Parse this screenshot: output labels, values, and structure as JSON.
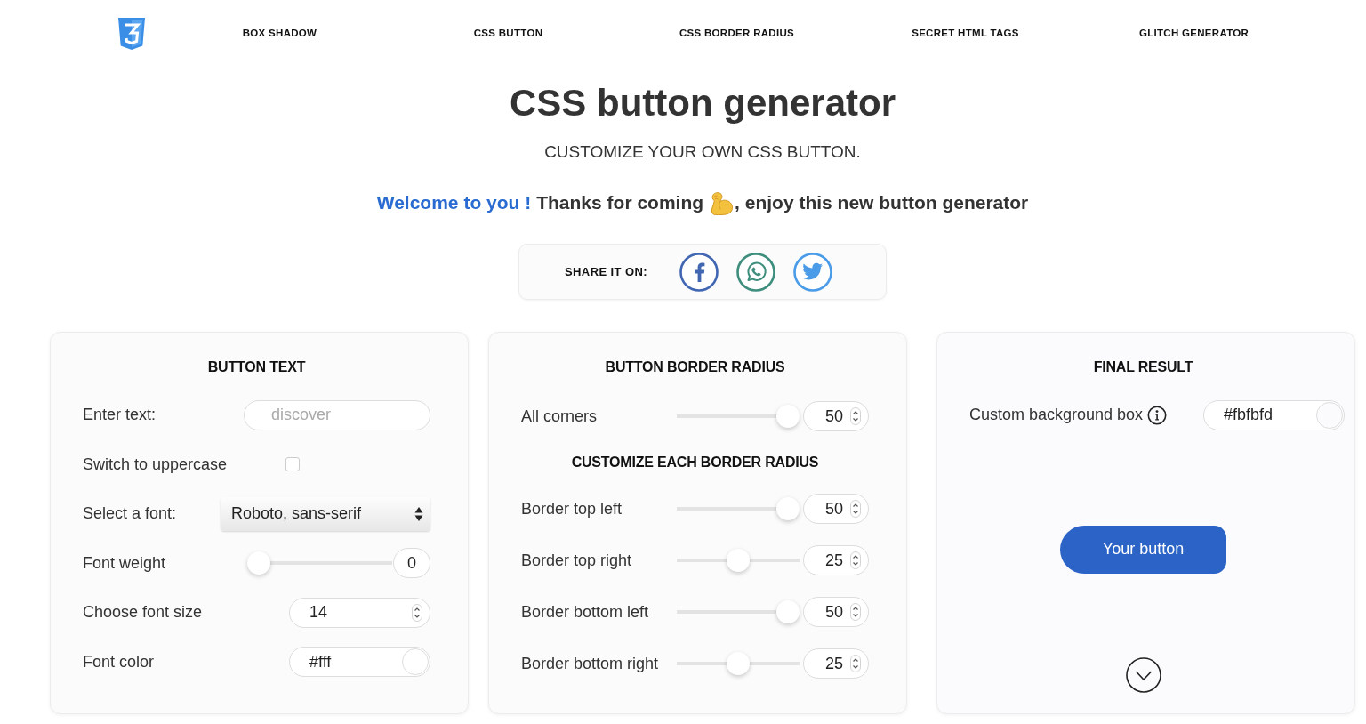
{
  "nav": {
    "links": [
      "BOX SHADOW",
      "CSS BUTTON",
      "CSS BORDER RADIUS",
      "SECRET HTML TAGS",
      "GLITCH GENERATOR"
    ]
  },
  "header": {
    "title": "CSS button generator",
    "subtitle": "CUSTOMIZE YOUR OWN CSS BUTTON.",
    "welcome": {
      "greeting": "Welcome to you !",
      "text_before_icon": "Thanks for coming",
      "text_after_icon": ", enjoy this new button generator"
    }
  },
  "share": {
    "label": "SHARE IT ON:",
    "networks": [
      {
        "kind": "facebook"
      },
      {
        "kind": "whatsapp"
      },
      {
        "kind": "twitter"
      }
    ]
  },
  "panels": [
    {
      "title": "BUTTON TEXT",
      "items": [
        {
          "kind": "text",
          "label": "Enter text:",
          "placeholder": "discover"
        },
        {
          "kind": "checkbox",
          "label": "Switch to uppercase",
          "checked": false
        },
        {
          "kind": "select",
          "label": "Select a font:",
          "value": "Roboto, sans-serif"
        },
        {
          "kind": "slider",
          "label": "Font weight",
          "level": 0,
          "value": "0",
          "stepper": false
        },
        {
          "kind": "number",
          "label": "Choose font size",
          "value": "14"
        },
        {
          "kind": "color",
          "label": "Font color",
          "value": "#fff",
          "info": false
        }
      ]
    },
    {
      "title": "BUTTON BORDER RADIUS",
      "items": [
        {
          "kind": "slider",
          "label": "All corners",
          "level": 1,
          "value": "50",
          "stepper": true
        },
        {
          "kind": "heading",
          "text": "CUSTOMIZE EACH BORDER RADIUS"
        },
        {
          "kind": "slider",
          "label": "Border top left",
          "level": 1,
          "value": "50",
          "stepper": true
        },
        {
          "kind": "slider",
          "label": "Border top right",
          "level": 0.5,
          "value": "25",
          "stepper": true
        },
        {
          "kind": "slider",
          "label": "Border bottom left",
          "level": 1,
          "value": "50",
          "stepper": true
        },
        {
          "kind": "slider",
          "label": "Border bottom right",
          "level": 0.5,
          "value": "25",
          "stepper": true
        }
      ]
    },
    {
      "title": "FINAL RESULT",
      "items": [
        {
          "kind": "color",
          "label": "Custom background box",
          "value": "#fbfbfd",
          "info": true
        },
        {
          "kind": "preview",
          "label": "Your button"
        },
        {
          "kind": "scroll"
        }
      ]
    }
  ]
}
